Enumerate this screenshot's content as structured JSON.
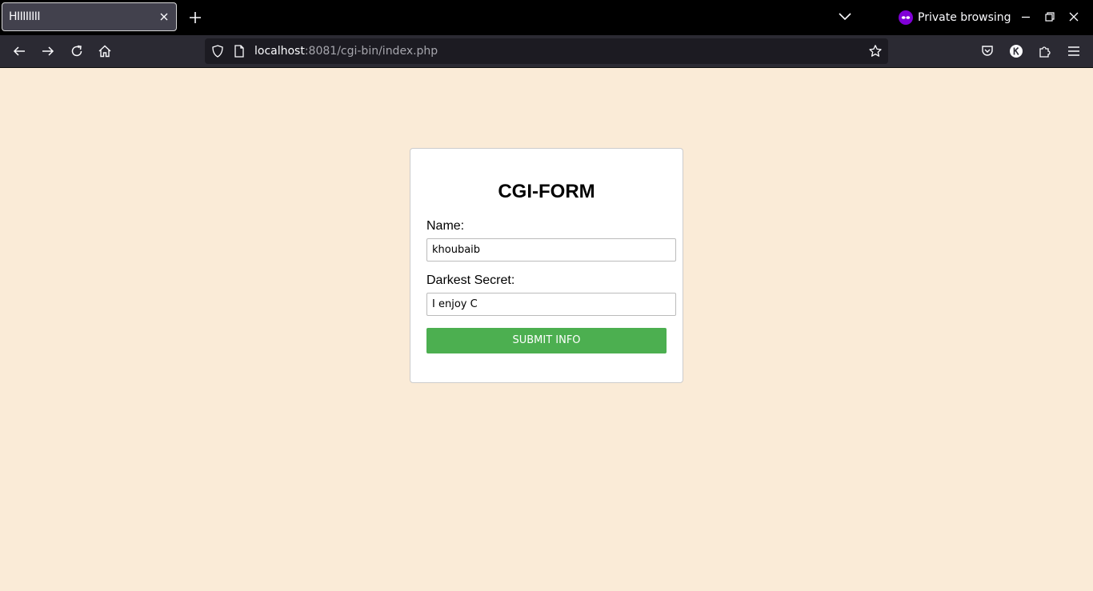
{
  "browser": {
    "tab": {
      "title": "HIIIIIIII"
    },
    "private_label": "Private browsing",
    "url": {
      "host": "localhost",
      "path": ":8081/cgi-bin/index.php"
    }
  },
  "form": {
    "title": "CGI-FORM",
    "name_label": "Name:",
    "name_value": "khoubaib",
    "secret_label": "Darkest Secret:",
    "secret_value": "I enjoy C",
    "submit_label": "SUBMIT INFO"
  },
  "colors": {
    "page_background": "#FAEBD7",
    "submit_button": "#4CAF50",
    "private_accent": "#8000D7"
  }
}
